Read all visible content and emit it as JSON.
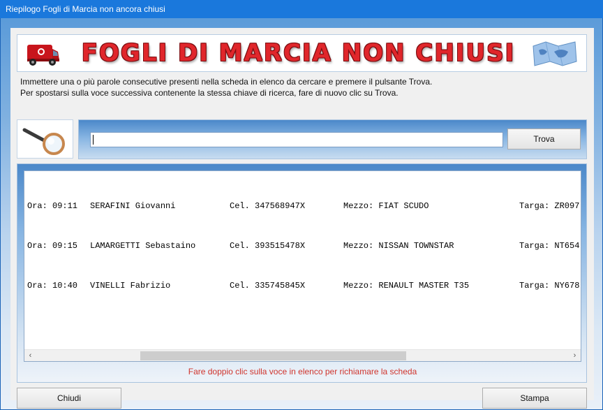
{
  "window": {
    "title": "Riepilogo Fogli di Marcia non ancora chiusi"
  },
  "banner": {
    "title": "FOGLI DI MARCIA NON CHIUSI",
    "van_icon": "van-icon",
    "map_icon": "map-icon"
  },
  "instructions": {
    "line1": "Immettere una o più parole consecutive presenti nella scheda in elenco da cercare e premere il pulsante Trova.",
    "line2": "Per spostarsi sulla voce successiva contenente la stessa chiave di ricerca, fare di nuovo clic su Trova."
  },
  "search": {
    "icon": "magnifier-icon",
    "value": "",
    "button_label": "Trova"
  },
  "list": {
    "rows": [
      {
        "ora": "Ora: 09:11",
        "name": "SERAFINI Giovanni",
        "cel": "Cel. 347568947X",
        "mezzo": "Mezzo: FIAT SCUDO",
        "targa": "Targa: ZR097"
      },
      {
        "ora": "Ora: 09:15",
        "name": "LAMARGETTI Sebastaino",
        "cel": "Cel. 393515478X",
        "mezzo": "Mezzo: NISSAN TOWNSTAR",
        "targa": "Targa: NT654"
      },
      {
        "ora": "Ora: 10:40",
        "name": "VINELLI Fabrizio",
        "cel": "Cel. 335745845X",
        "mezzo": "Mezzo: RENAULT MASTER T35",
        "targa": "Targa: NY678"
      }
    ],
    "scroll_left": "‹",
    "scroll_right": "›"
  },
  "hint": "Fare doppio clic sulla voce in elenco per richiamare la scheda",
  "footer": {
    "close_label": "Chiudi",
    "print_label": "Stampa"
  },
  "colors": {
    "banner_text": "#e0262b",
    "hint_text": "#d0342c",
    "title_bar": "#1a78dc"
  }
}
